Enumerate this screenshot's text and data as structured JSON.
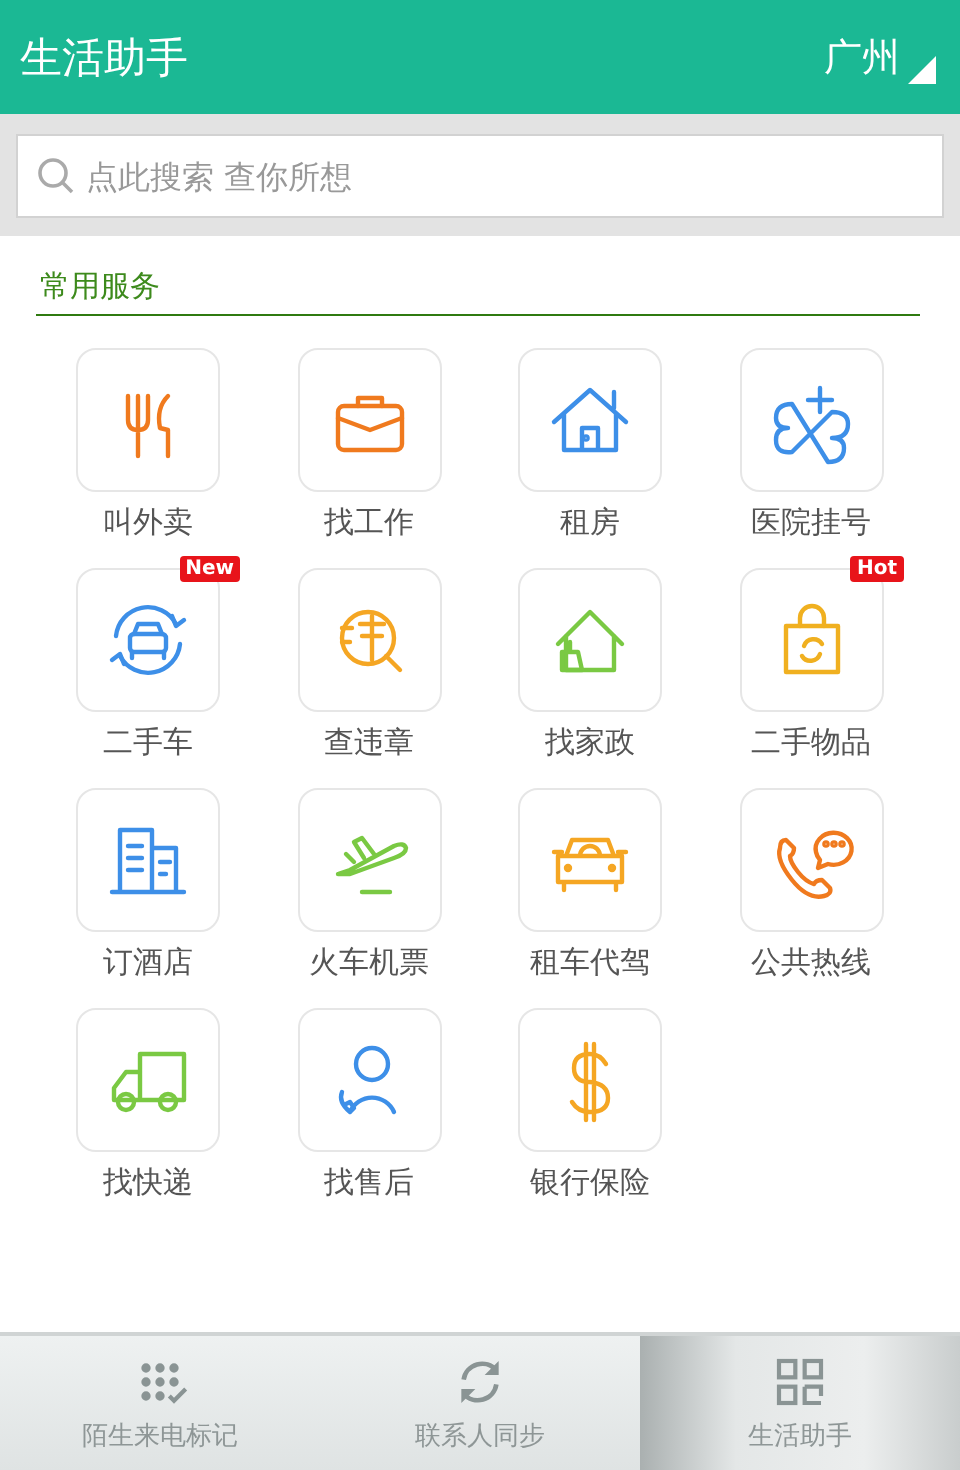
{
  "header": {
    "title": "生活助手",
    "city": "广州"
  },
  "search": {
    "placeholder": "点此搜索 查你所想"
  },
  "section": {
    "title": "常用服务"
  },
  "services": [
    {
      "label": "叫外卖",
      "kind": "cutlery",
      "color": "#f07a1e"
    },
    {
      "label": "找工作",
      "kind": "briefcase",
      "color": "#f07a1e"
    },
    {
      "label": "租房",
      "kind": "house",
      "color": "#3d8fe8"
    },
    {
      "label": "医院挂号",
      "kind": "medical",
      "color": "#3d8fe8"
    },
    {
      "label": "二手车",
      "kind": "car-cycle",
      "color": "#3d8fe8",
      "badge": "New"
    },
    {
      "label": "查违章",
      "kind": "magnifier",
      "color": "#f5a623"
    },
    {
      "label": "找家政",
      "kind": "house-broom",
      "color": "#7ac943"
    },
    {
      "label": "二手物品",
      "kind": "bag",
      "color": "#f0b020",
      "badge": "Hot"
    },
    {
      "label": "订酒店",
      "kind": "building",
      "color": "#3d8fe8"
    },
    {
      "label": "火车机票",
      "kind": "plane",
      "color": "#7ac943"
    },
    {
      "label": "租车代驾",
      "kind": "taxi",
      "color": "#f5a623"
    },
    {
      "label": "公共热线",
      "kind": "phone-chat",
      "color": "#f07a1e"
    },
    {
      "label": "找快递",
      "kind": "truck",
      "color": "#7ac943"
    },
    {
      "label": "找售后",
      "kind": "person-phone",
      "color": "#3d8fe8"
    },
    {
      "label": "银行保险",
      "kind": "dollar",
      "color": "#f5a623"
    }
  ],
  "tabs": [
    {
      "label": "陌生来电标记",
      "selected": false
    },
    {
      "label": "联系人同步",
      "selected": false
    },
    {
      "label": "生活助手",
      "selected": true
    }
  ]
}
